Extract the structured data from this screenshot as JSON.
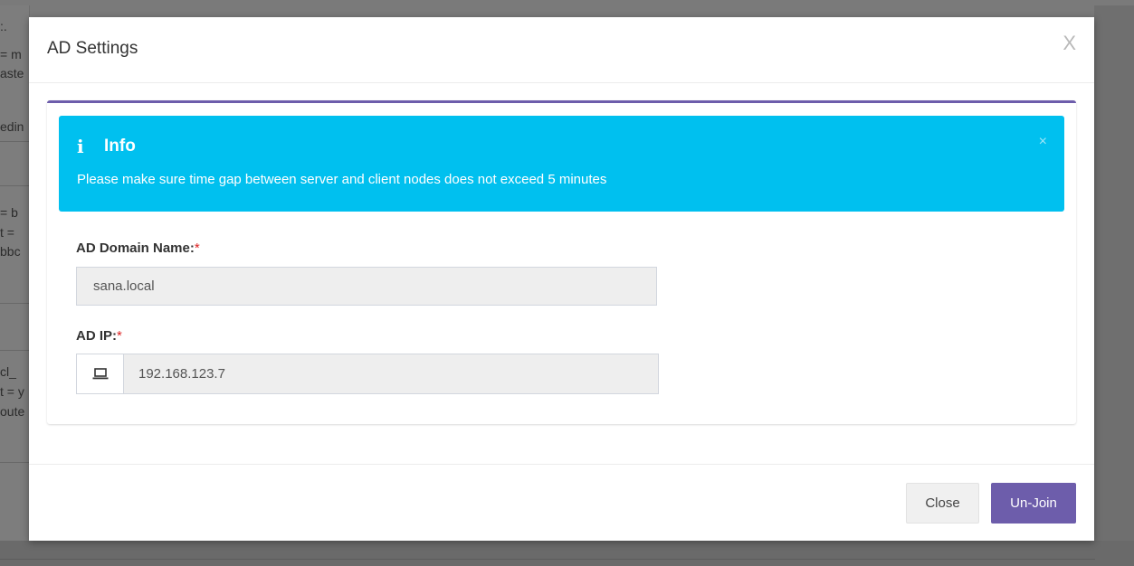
{
  "background_fragments": [
    ":.",
    "= m",
    "aste",
    "edin",
    "= b",
    "t =",
    "bbc",
    "cl_",
    "t = y",
    "oute"
  ],
  "modal": {
    "title": "AD Settings",
    "close_glyph": "X"
  },
  "alert": {
    "icon_glyph": "i",
    "title": "Info",
    "close_glyph": "×",
    "message": "Please make sure time gap between server and client nodes does not exceed 5 minutes"
  },
  "form": {
    "domain": {
      "label": "AD Domain Name:",
      "required_mark": "*",
      "value": "sana.local"
    },
    "ip": {
      "label": "AD IP:",
      "required_mark": "*",
      "value": "192.168.123.7",
      "icon": "laptop-icon"
    }
  },
  "footer": {
    "close_label": "Close",
    "unjoin_label": "Un-Join"
  },
  "colors": {
    "accent": "#6d5dab",
    "alert_bg": "#00c0ef",
    "required": "#dd2222"
  }
}
